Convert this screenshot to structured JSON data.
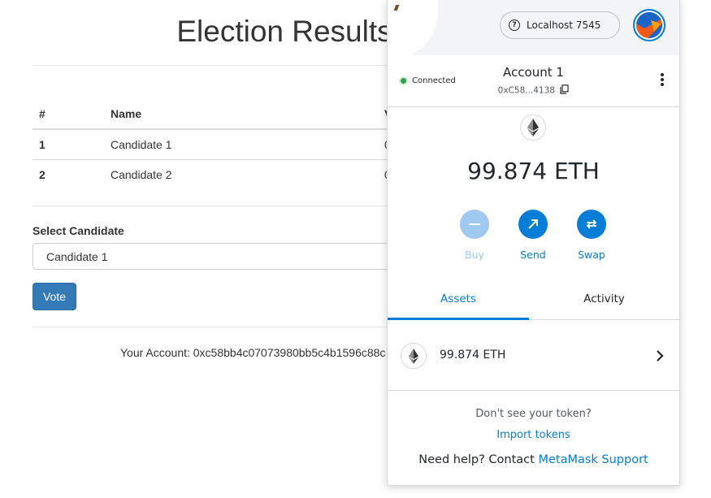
{
  "dapp": {
    "title": "Election Results",
    "table": {
      "headers": [
        "#",
        "Name",
        "V"
      ],
      "rows": [
        {
          "num": "1",
          "name": "Candidate 1",
          "votes": "0"
        },
        {
          "num": "2",
          "name": "Candidate 2",
          "votes": "0"
        }
      ]
    },
    "select_label": "Select Candidate",
    "select_value": "Candidate 1",
    "vote_label": "Vote",
    "account_text": "Your Account: 0xc58bb4c07073980bb5c4b1596c88c"
  },
  "metamask": {
    "network": "Localhost 7545",
    "status": "Connected",
    "account_name": "Account 1",
    "account_address": "0xC58...4138",
    "balance": "99.874 ETH",
    "actions": [
      {
        "label": "Buy",
        "icon": "minus-icon",
        "enabled": false
      },
      {
        "label": "Send",
        "icon": "arrow-up-right-icon",
        "enabled": true
      },
      {
        "label": "Swap",
        "icon": "swap-arrows-icon",
        "enabled": true
      }
    ],
    "tabs": [
      "Assets",
      "Activity"
    ],
    "active_tab": "Assets",
    "assets": [
      {
        "amount": "99.874 ETH",
        "icon": "ethereum-icon"
      }
    ],
    "no_token_text": "Don't see your token?",
    "import_tokens": "Import tokens",
    "help_prefix": "Need help? Contact ",
    "help_link": "MetaMask Support"
  },
  "colors": {
    "accent": "#037dd6",
    "bootstrap_primary": "#337ab7",
    "connected": "#28a745"
  }
}
